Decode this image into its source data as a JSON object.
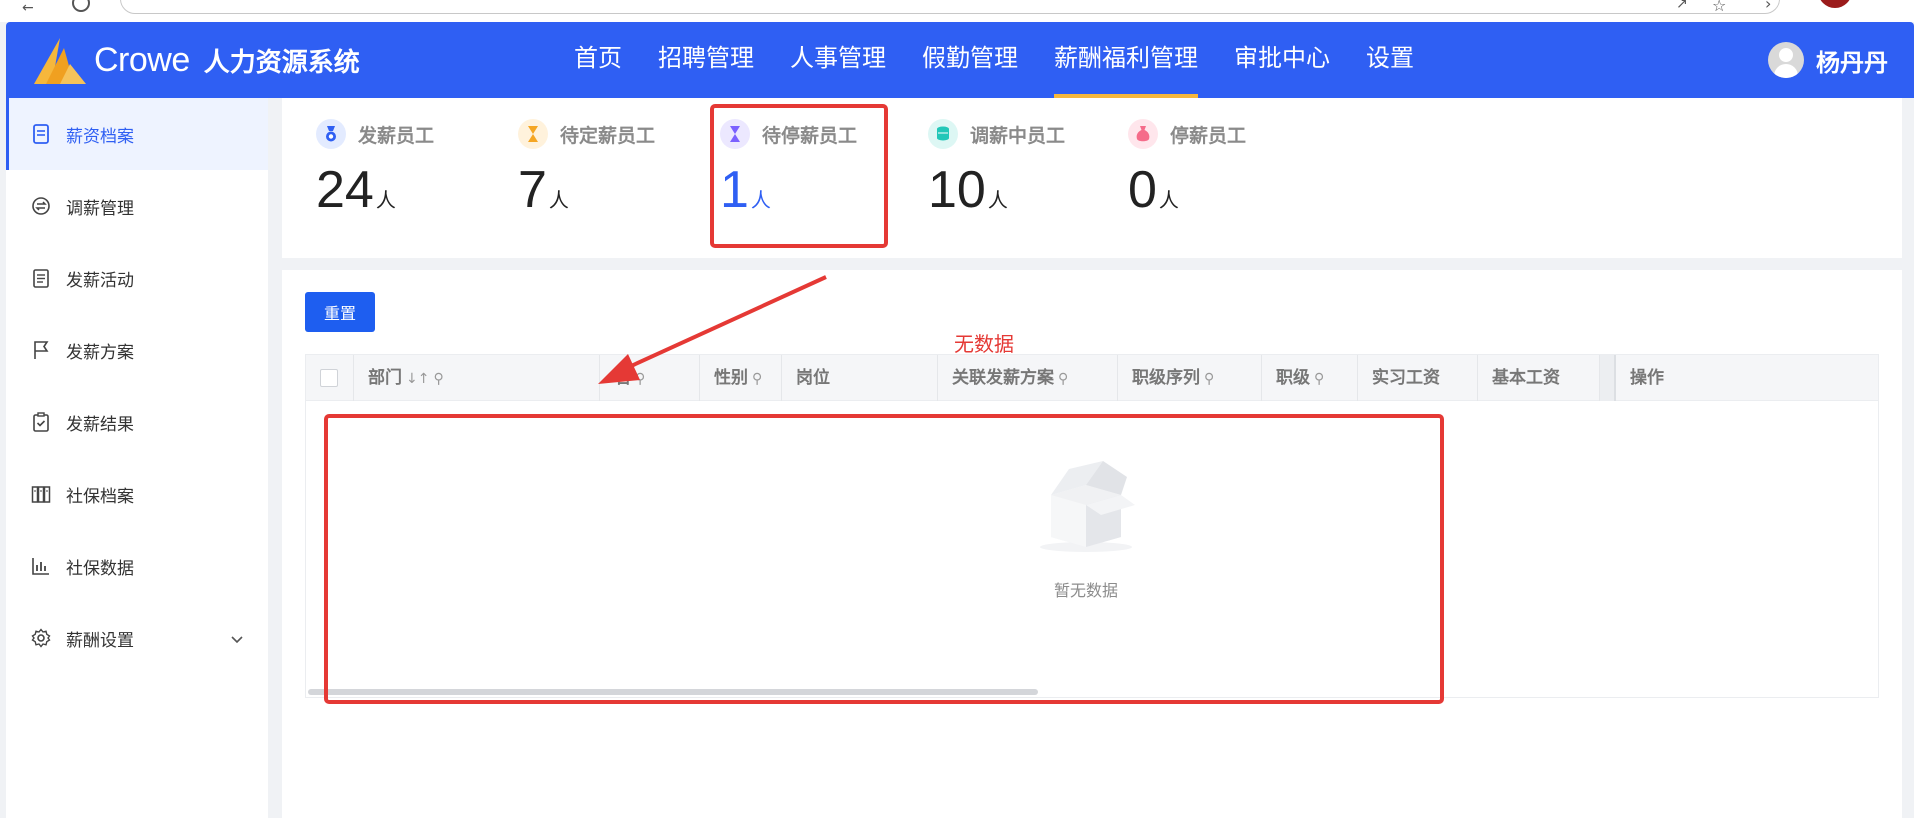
{
  "brand": {
    "logo_text": "Crowe",
    "system_name": "人力资源系统"
  },
  "nav": {
    "items": [
      {
        "label": "首页"
      },
      {
        "label": "招聘管理"
      },
      {
        "label": "人事管理"
      },
      {
        "label": "假勤管理"
      },
      {
        "label": "薪酬福利管理",
        "active": true
      },
      {
        "label": "审批中心"
      },
      {
        "label": "设置"
      }
    ]
  },
  "user": {
    "name": "杨丹丹"
  },
  "sidebar": {
    "items": [
      {
        "label": "薪资档案",
        "icon": "file-icon",
        "active": true
      },
      {
        "label": "调薪管理",
        "icon": "swap-icon"
      },
      {
        "label": "发薪活动",
        "icon": "clipboard-icon"
      },
      {
        "label": "发薪方案",
        "icon": "flag-icon"
      },
      {
        "label": "发薪结果",
        "icon": "clipboard-check-icon"
      },
      {
        "label": "社保档案",
        "icon": "archive-icon"
      },
      {
        "label": "社保数据",
        "icon": "bar-chart-icon"
      },
      {
        "label": "薪酬设置",
        "icon": "gear-icon"
      }
    ]
  },
  "stats": [
    {
      "label": "发薪员工",
      "value": "24",
      "unit": "人",
      "icon": "medal-icon",
      "color": "#2f5ff3"
    },
    {
      "label": "待定薪员工",
      "value": "7",
      "unit": "人",
      "icon": "hourglass-icon",
      "color": "#f5a623"
    },
    {
      "label": "待停薪员工",
      "value": "1",
      "unit": "人",
      "icon": "hourglass-icon",
      "color": "#7b61ff"
    },
    {
      "label": "调薪中员工",
      "value": "10",
      "unit": "人",
      "icon": "coins-icon",
      "color": "#22c7b8"
    },
    {
      "label": "停薪员工",
      "value": "0",
      "unit": "人",
      "icon": "money-bag-icon",
      "color": "#f56c8a"
    }
  ],
  "toolbar": {
    "reset_label": "重置"
  },
  "annotation": {
    "no_data_label": "无数据"
  },
  "table": {
    "columns": [
      "部门",
      "名",
      "性别",
      "岗位",
      "关联发薪方案",
      "职级序列",
      "职级",
      "实习工资",
      "基本工资",
      "操作"
    ],
    "empty_text": "暂无数据"
  }
}
